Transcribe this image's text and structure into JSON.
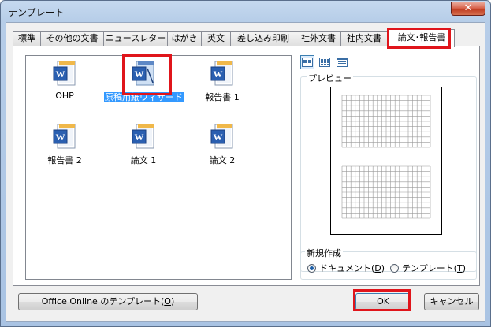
{
  "window": {
    "title": "テンプレート",
    "close_label": "✕"
  },
  "tabs": [
    {
      "label": "標準"
    },
    {
      "label": "その他の文書"
    },
    {
      "label": "ニュースレター"
    },
    {
      "label": "はがき"
    },
    {
      "label": "英文"
    },
    {
      "label": "差し込み印刷"
    },
    {
      "label": "社外文書"
    },
    {
      "label": "社内文書"
    },
    {
      "label": "論文･報告書",
      "active": true
    }
  ],
  "templates": [
    {
      "label": "OHP"
    },
    {
      "label": "原稿用紙ウィザード",
      "selected": true
    },
    {
      "label": "報告書 1"
    },
    {
      "label": "報告書 2"
    },
    {
      "label": "論文 1"
    },
    {
      "label": "論文 2"
    }
  ],
  "view_buttons": [
    {
      "icon": "large-icons-view-icon",
      "active": true
    },
    {
      "icon": "list-view-icon",
      "active": false
    },
    {
      "icon": "details-view-icon",
      "active": false
    }
  ],
  "preview": {
    "caption": "プレビュー"
  },
  "new_group": {
    "caption": "新規作成",
    "document_label": "ドキュメント(",
    "document_key": "D",
    "template_label": "テンプレート(",
    "template_key": "T",
    "close_paren": ")",
    "selected": "document"
  },
  "buttons": {
    "office_online_label": "Office Online のテンプレート(",
    "office_online_key": "O",
    "ok_label": "OK",
    "cancel_label": "キャンセル",
    "close_paren": ")"
  },
  "colors": {
    "highlight": "#e0151b",
    "selection": "#3399ff"
  }
}
